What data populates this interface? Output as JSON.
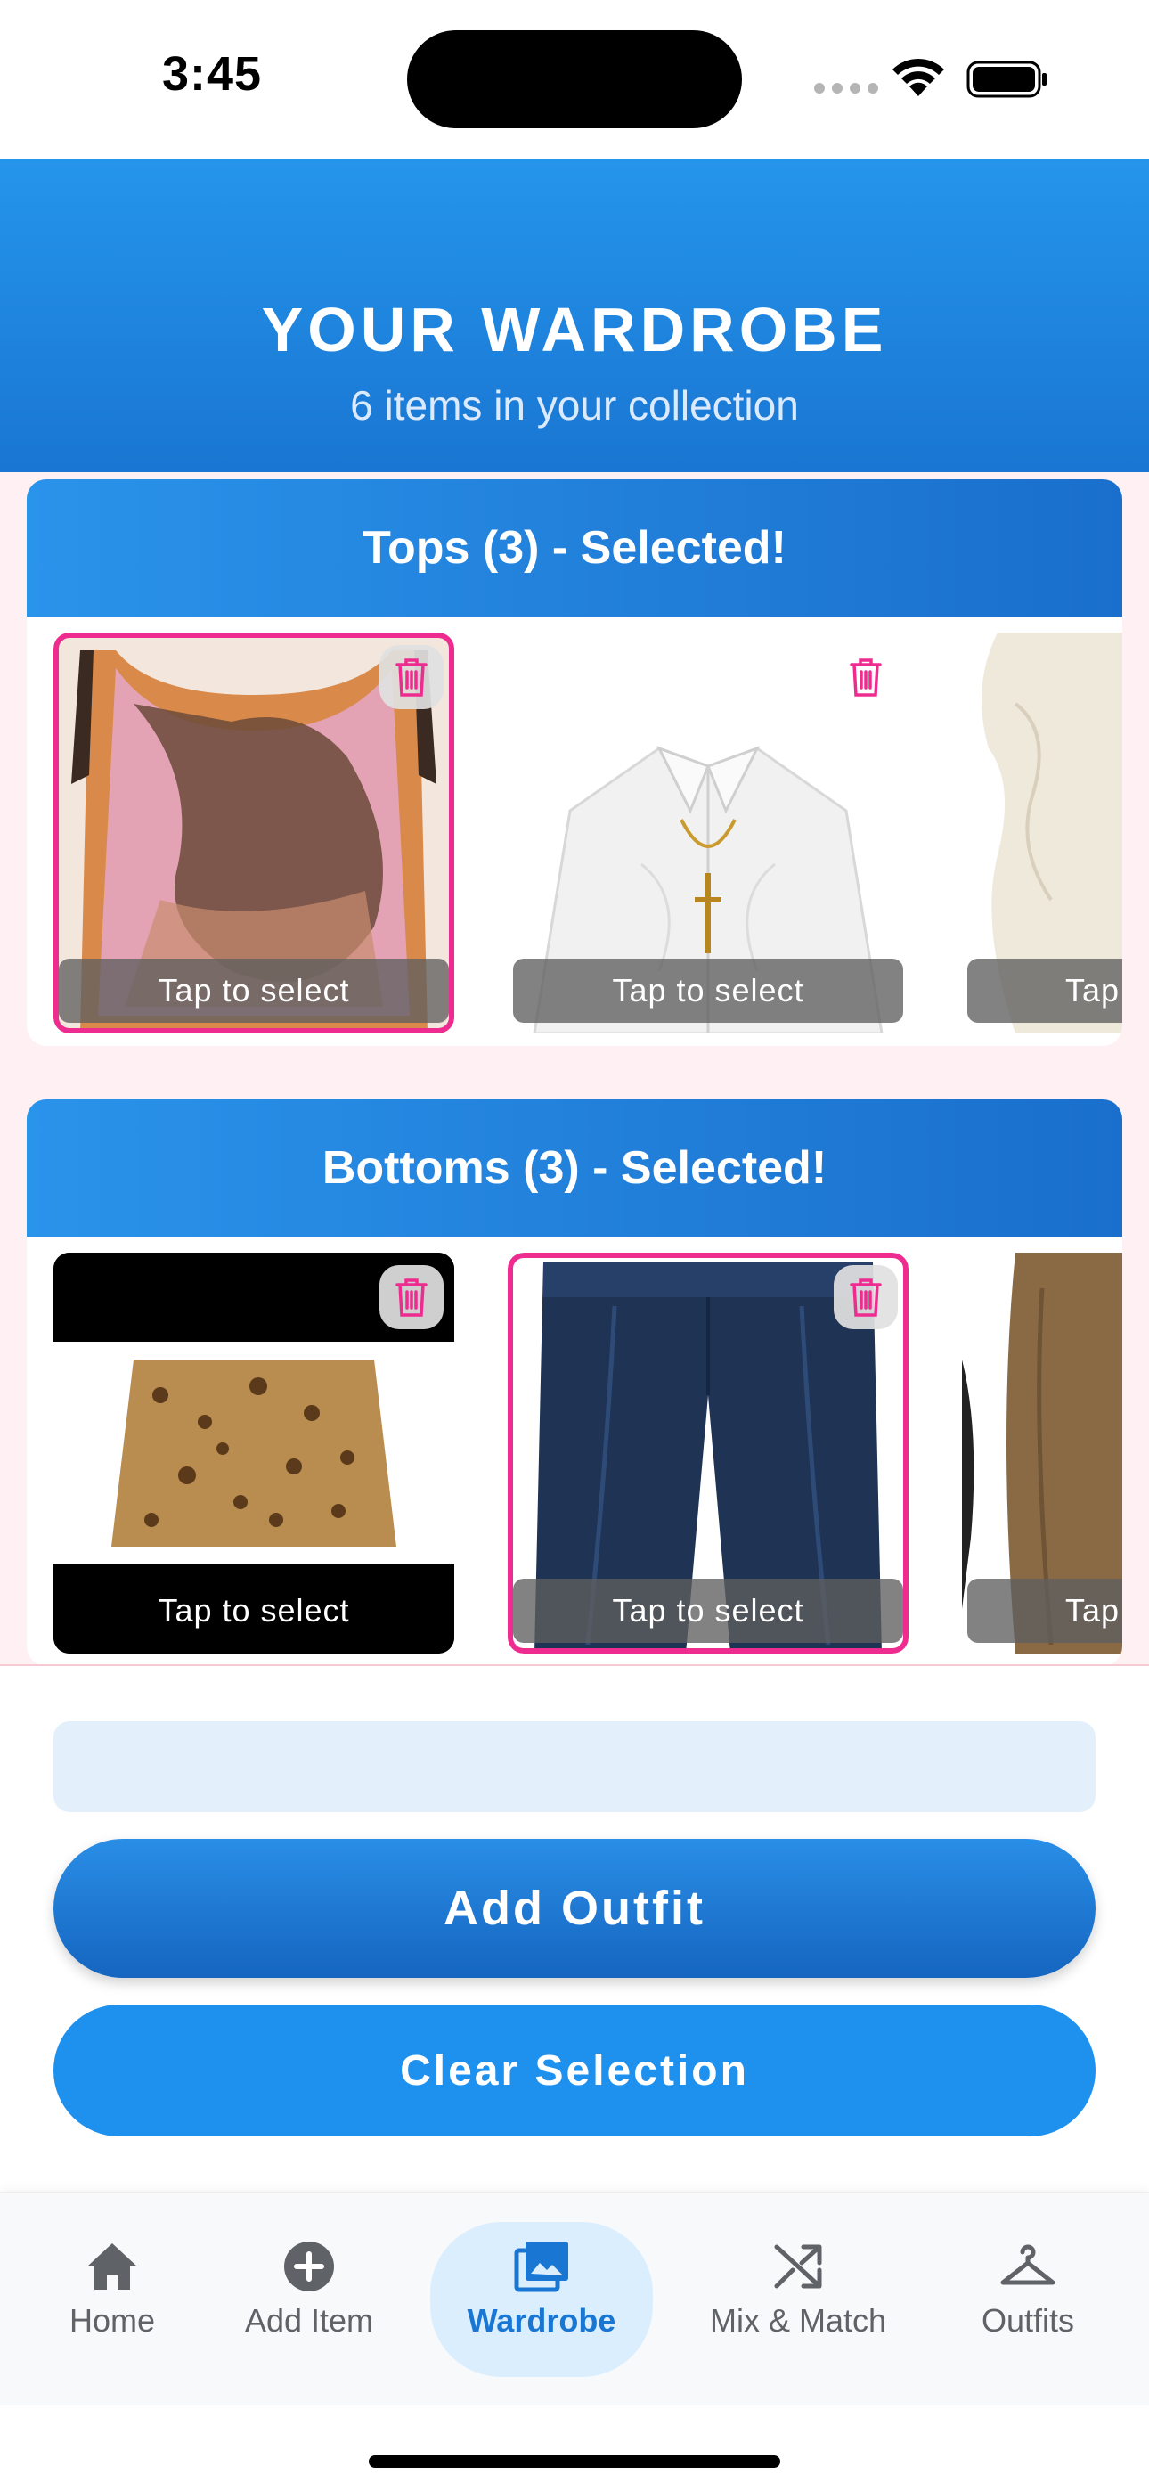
{
  "status_bar": {
    "time": "3:45"
  },
  "header": {
    "title": "YOUR WARDROBE",
    "subtitle": "6 items in your collection"
  },
  "categories": [
    {
      "title": "Tops (3) - Selected!",
      "items": [
        {
          "label": "Tap to select",
          "selected": true
        },
        {
          "label": "Tap to select",
          "selected": false
        },
        {
          "label": "Tap to select",
          "selected": false,
          "partial_text": "Tap"
        }
      ]
    },
    {
      "title": "Bottoms (3) - Selected!",
      "items": [
        {
          "label": "Tap to select",
          "selected": false
        },
        {
          "label": "Tap to select",
          "selected": true
        },
        {
          "label": "Tap to select",
          "selected": false,
          "partial_text": "Tap"
        }
      ]
    }
  ],
  "outfit_name": {
    "value": "",
    "placeholder": ""
  },
  "buttons": {
    "add_outfit": "Add Outfit",
    "clear_selection": "Clear Selection"
  },
  "nav": {
    "items": [
      {
        "label": "Home",
        "icon": "home-icon"
      },
      {
        "label": "Add Item",
        "icon": "add-circle-icon"
      },
      {
        "label": "Wardrobe",
        "icon": "photo-library-icon",
        "active": true
      },
      {
        "label": "Mix & Match",
        "icon": "shuffle-icon"
      },
      {
        "label": "Outfits",
        "icon": "hanger-icon"
      }
    ]
  },
  "colors": {
    "primary": "#1976d2",
    "accent_pink": "#ee2c8f",
    "content_bg": "#fff0f3"
  }
}
